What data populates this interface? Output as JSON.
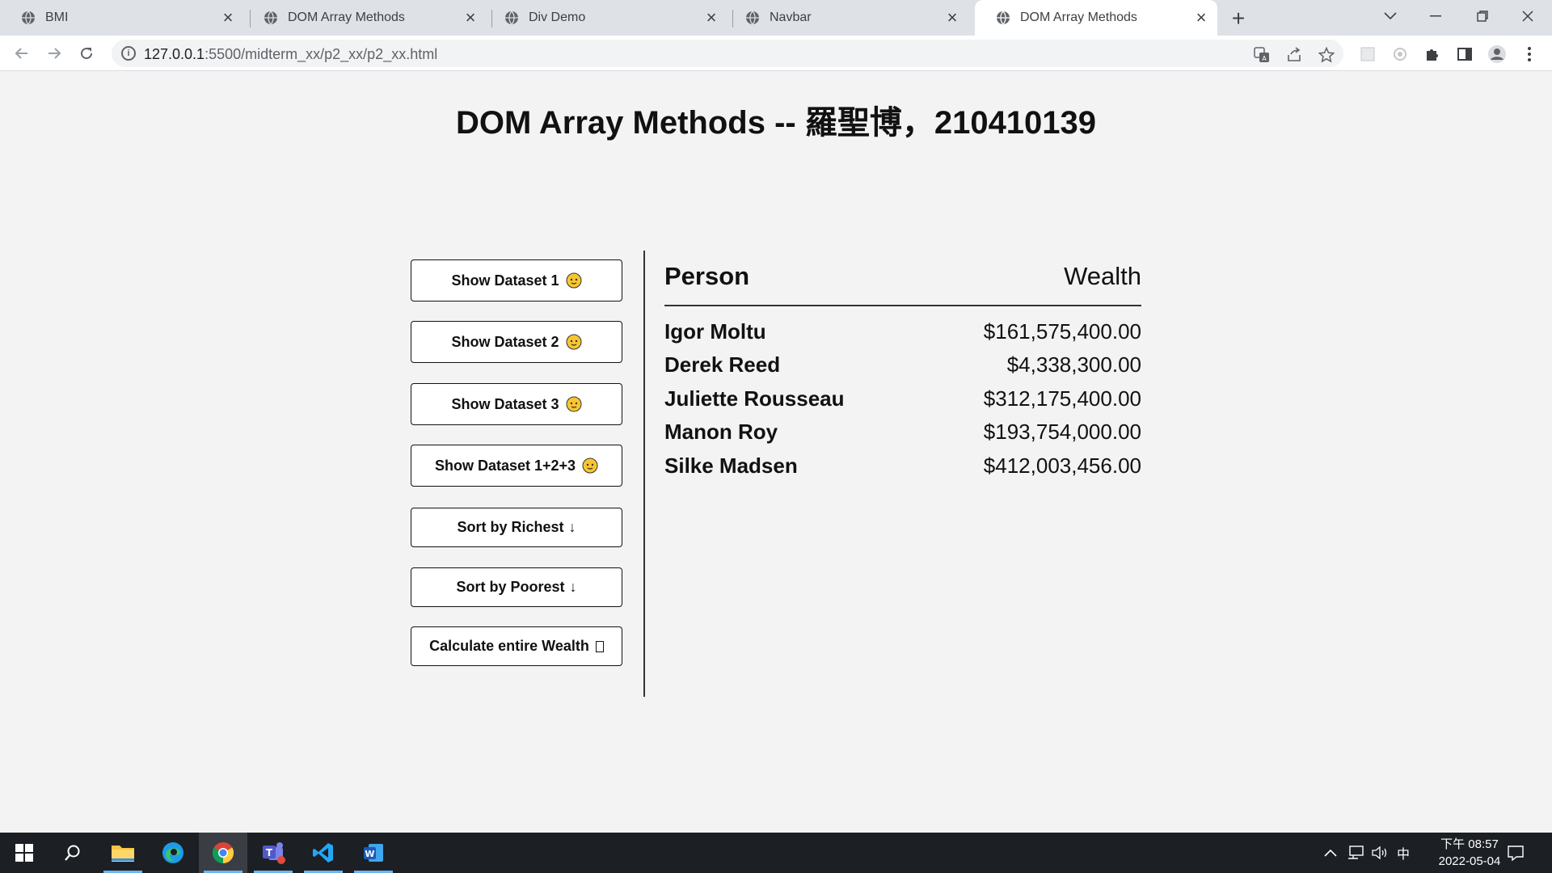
{
  "browser": {
    "tabs": [
      {
        "title": "BMI",
        "active": false
      },
      {
        "title": "DOM Array Methods",
        "active": false
      },
      {
        "title": "Div Demo",
        "active": false
      },
      {
        "title": "Navbar",
        "active": false
      },
      {
        "title": "DOM Array Methods",
        "active": true
      }
    ],
    "url_host": "127.0.0.1",
    "url_path": ":5500/midterm_xx/p2_xx/p2_xx.html"
  },
  "page": {
    "title": "DOM Array Methods -- 羅聖博，210410139",
    "buttons": [
      {
        "label": "Show Dataset 1",
        "suffix": "emoji"
      },
      {
        "label": "Show Dataset 2",
        "suffix": "emoji"
      },
      {
        "label": "Show Dataset 3",
        "suffix": "emoji"
      },
      {
        "label": "Show Dataset 1+2+3",
        "suffix": "emoji"
      },
      {
        "label": "Sort by Richest",
        "suffix": "↓"
      },
      {
        "label": "Sort by Poorest",
        "suffix": "↓"
      },
      {
        "label": "Calculate entire Wealth",
        "suffix": "tofu"
      }
    ],
    "table": {
      "header_person": "Person",
      "header_wealth": "Wealth",
      "rows": [
        {
          "name": "Igor Moltu",
          "wealth": "$161,575,400.00"
        },
        {
          "name": "Derek Reed",
          "wealth": "$4,338,300.00"
        },
        {
          "name": "Juliette Rousseau",
          "wealth": "$312,175,400.00"
        },
        {
          "name": "Manon Roy",
          "wealth": "$193,754,000.00"
        },
        {
          "name": "Silke Madsen",
          "wealth": "$412,003,456.00"
        }
      ]
    }
  },
  "taskbar": {
    "ime": "中",
    "clock_time": "下午 08:57",
    "clock_date": "2022-05-04"
  },
  "colors": {
    "page_bg": "#f3f3f3",
    "tabstrip_bg": "#dee1e6",
    "taskbar_bg": "#1c1f24",
    "emoji_yellow": "#f7c531"
  }
}
